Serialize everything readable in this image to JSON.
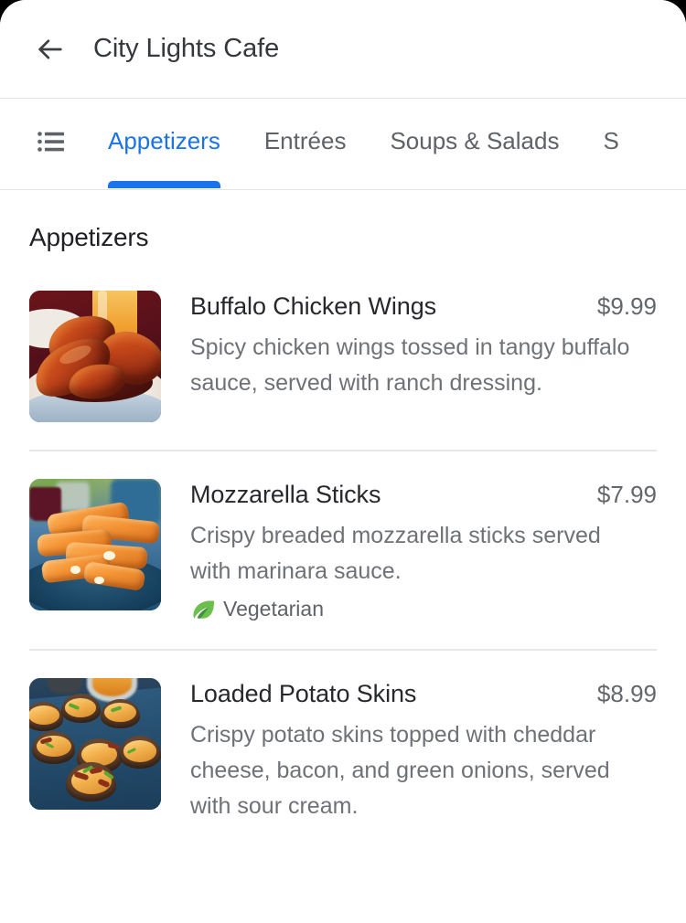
{
  "window": {
    "background": "#000000",
    "surface": "#ffffff",
    "corner_radius_px": 28
  },
  "header": {
    "back_icon": "back-arrow-icon",
    "title": "City Lights Cafe"
  },
  "tab_bar": {
    "list_icon": "list-menu-icon",
    "active_color": "#1a73e8",
    "inactive_color": "#5f6368",
    "tabs": [
      {
        "label": "Appetizers",
        "active": true
      },
      {
        "label": "Entrées",
        "active": false
      },
      {
        "label": "Soups & Salads",
        "active": false
      },
      {
        "label": "S",
        "active": false,
        "truncated": true
      }
    ]
  },
  "content": {
    "section_title": "Appetizers",
    "items": [
      {
        "name": "Buffalo Chicken Wings",
        "price": "$9.99",
        "description": "Spicy chicken wings tossed in tangy buffalo sauce, served with ranch dressing.",
        "image": "buffalo-chicken-wings-photo",
        "tags": []
      },
      {
        "name": "Mozzarella Sticks",
        "price": "$7.99",
        "description": "Crispy breaded mozzarella sticks served with marinara sauce.",
        "image": "mozzarella-sticks-photo",
        "tags": [
          {
            "label": "Vegetarian",
            "icon": "leaf-icon",
            "color": "#3f9142"
          }
        ]
      },
      {
        "name": "Loaded Potato Skins",
        "price": "$8.99",
        "description": "Crispy potato skins topped with cheddar cheese, bacon, and green onions, served with sour cream.",
        "image": "loaded-potato-skins-photo",
        "tags": []
      }
    ]
  }
}
